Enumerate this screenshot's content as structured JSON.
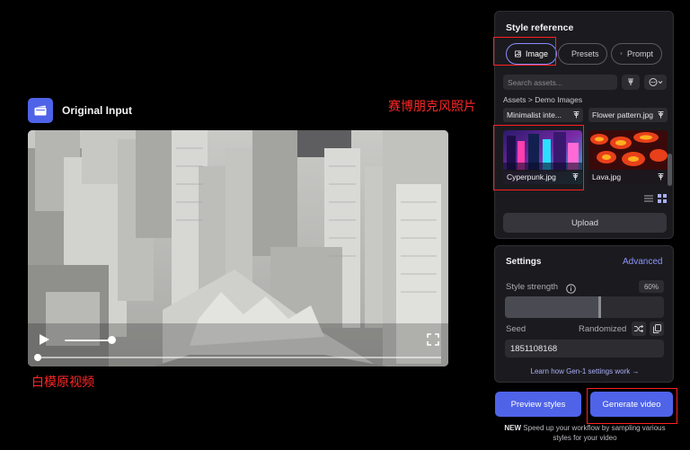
{
  "original": {
    "title": "Original Input",
    "progress": 0.0,
    "volume": 1.0
  },
  "annotations": {
    "left_caption": "白模原视频",
    "top_caption": "赛博朋克风照片",
    "box_color": "#ff1f1f"
  },
  "style_reference": {
    "title": "Style reference",
    "tabs": [
      {
        "label": "Image",
        "icon": "image-icon",
        "active": true
      },
      {
        "label": "Presets",
        "icon": "palette-icon",
        "active": false
      },
      {
        "label": "Prompt",
        "icon": "text-t-icon",
        "active": false
      }
    ],
    "search_placeholder": "Search assets...",
    "breadcrumb": "Assets > Demo Images",
    "asset_rows": [
      {
        "label": "Minimalist inte...",
        "icon": "pin-icon"
      },
      {
        "label": "Flower pattern.jpg",
        "icon": "pin-icon"
      }
    ],
    "thumbnails": [
      {
        "label": "Cyperpunk.jpg",
        "icon": "pin-icon",
        "selected": true
      },
      {
        "label": "Lava.jpg",
        "icon": "pin-icon",
        "selected": false
      }
    ],
    "upload_label": "Upload"
  },
  "settings": {
    "title": "Settings",
    "advanced_label": "Advanced",
    "style_strength_label": "Style strength",
    "style_strength_value": "60%",
    "style_strength_fraction": 0.6,
    "seed_label": "Seed",
    "seed_mode": "Randomized",
    "seed_value": "1851108168",
    "learn_link": "Learn how Gen-1 settings work →"
  },
  "actions": {
    "preview_label": "Preview styles",
    "generate_label": "Generate video",
    "note_badge": "NEW",
    "note_text": "Speed up your workflow by sampling various styles for your video"
  },
  "colors": {
    "accent": "#4f63e8",
    "panel_bg": "#1b1b1f",
    "link": "#8c95ff"
  }
}
